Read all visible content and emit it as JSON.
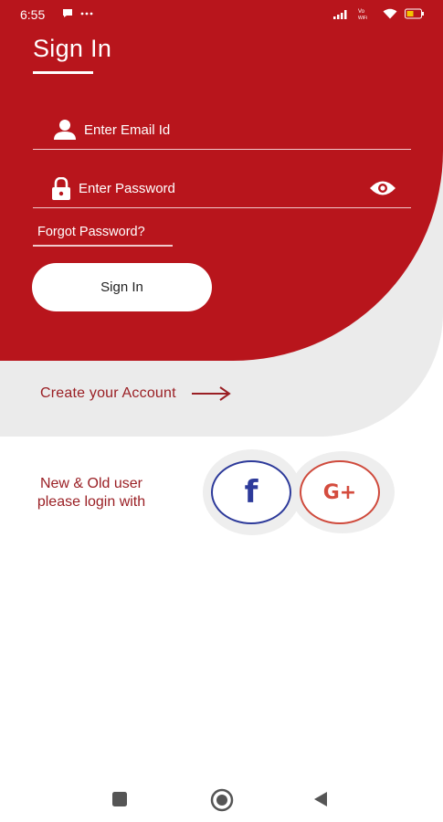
{
  "status_bar": {
    "time": "6:55",
    "icons": [
      "chat-bubble-icon",
      "more-dots-icon",
      "signal-icon",
      "volte-icon",
      "wifi-icon",
      "battery-icon"
    ],
    "volte_text": "Vo WiFi"
  },
  "sign_in": {
    "title": "Sign In",
    "email_placeholder": "Enter Email Id",
    "password_placeholder": "Enter Password",
    "forgot_password": "Forgot Password?",
    "button_label": "Sign In"
  },
  "create_account": {
    "label": "Create your Account"
  },
  "social": {
    "text_line1": "New & Old user",
    "text_line2": "please login with",
    "facebook_glyph": "f",
    "google_glyph": "G+"
  },
  "nav_bar": {
    "buttons": [
      "recents-square-icon",
      "home-circle-icon",
      "back-triangle-icon"
    ]
  },
  "colors": {
    "primary_red": "#b8151c",
    "accent_text": "#9a1f24",
    "facebook_blue": "#2d3a9a",
    "google_red": "#cf4a3c",
    "background": "#ffffff",
    "panel_grey": "#ebebeb"
  }
}
